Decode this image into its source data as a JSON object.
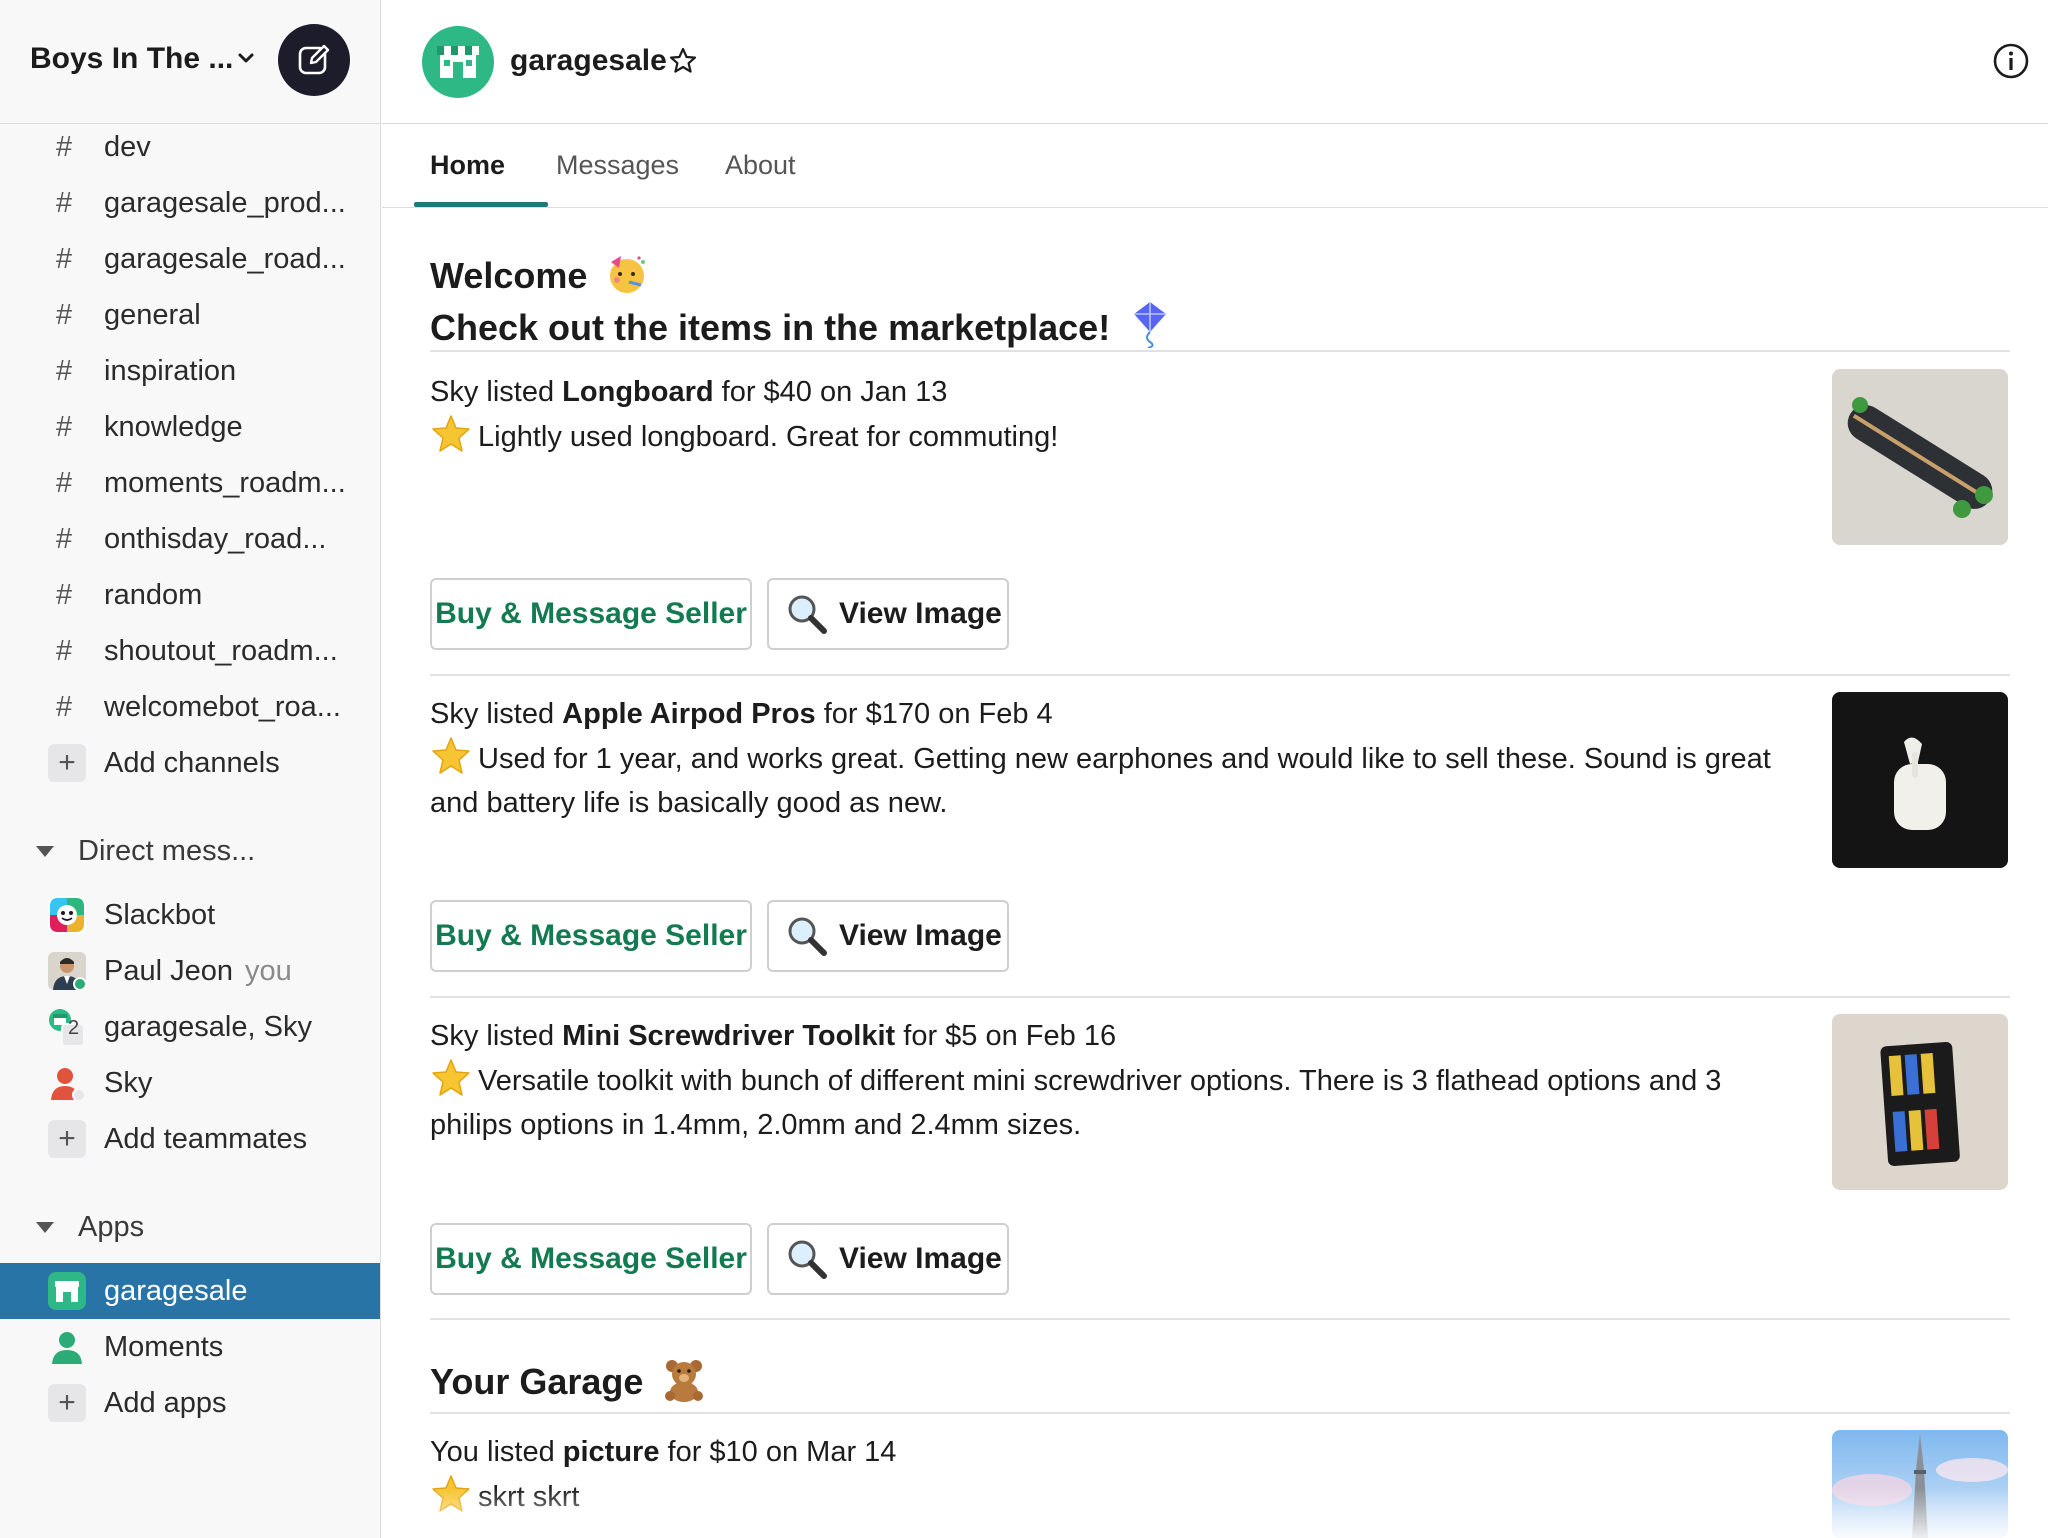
{
  "workspace": {
    "name": "Boys In The ..."
  },
  "channels": [
    "dev",
    "garagesale_prod...",
    "garagesale_road...",
    "general",
    "inspiration",
    "knowledge",
    "moments_roadm...",
    "onthisday_road...",
    "random",
    "shoutout_roadm...",
    "welcomebot_roa..."
  ],
  "add_channels": "Add channels",
  "dm_section": "Direct mess...",
  "dms": {
    "slackbot": "Slackbot",
    "paul": "Paul Jeon",
    "paul_you": "you",
    "group": "garagesale, Sky",
    "group_count": "2",
    "sky": "Sky"
  },
  "add_teammates": "Add teammates",
  "apps_section": "Apps",
  "apps": {
    "garagesale": "garagesale",
    "moments": "Moments"
  },
  "add_apps": "Add apps",
  "header": {
    "title": "garagesale"
  },
  "tabs": {
    "home": "Home",
    "messages": "Messages",
    "about": "About"
  },
  "home": {
    "welcome": "Welcome",
    "check_out": "Check out the items in the marketplace!",
    "your_garage": "Your Garage"
  },
  "listings": [
    {
      "seller": "Sky listed ",
      "item": "Longboard",
      "rest": " for $40 on Jan 13",
      "desc": "Lightly used longboard. Great for commuting!",
      "thumb": "longboard"
    },
    {
      "seller": "Sky listed ",
      "item": "Apple Airpod Pros",
      "rest": " for $170 on Feb 4",
      "desc": "Used for 1 year, and works great. Getting new earphones and would like to sell these. Sound is great and battery life is basically good as new.",
      "thumb": "airpods"
    },
    {
      "seller": "Sky listed ",
      "item": "Mini Screwdriver Toolkit",
      "rest": " for $5 on Feb 16",
      "desc": "Versatile toolkit with bunch of different mini screwdriver options. There is 3 flathead options and 3 philips options in 1.4mm, 2.0mm and 2.4mm sizes.",
      "thumb": "screwdriver-kit"
    }
  ],
  "my_listing": {
    "seller": "You listed ",
    "item": "picture",
    "rest": " for $10 on Mar 14",
    "desc": "skrt skrt",
    "thumb": "tower-photo"
  },
  "buttons": {
    "buy": "Buy & Message Seller",
    "view": "View Image"
  },
  "colors": {
    "accent_active": "#2874a6",
    "brand_green": "#2eb886",
    "buy_text": "#137a52"
  }
}
